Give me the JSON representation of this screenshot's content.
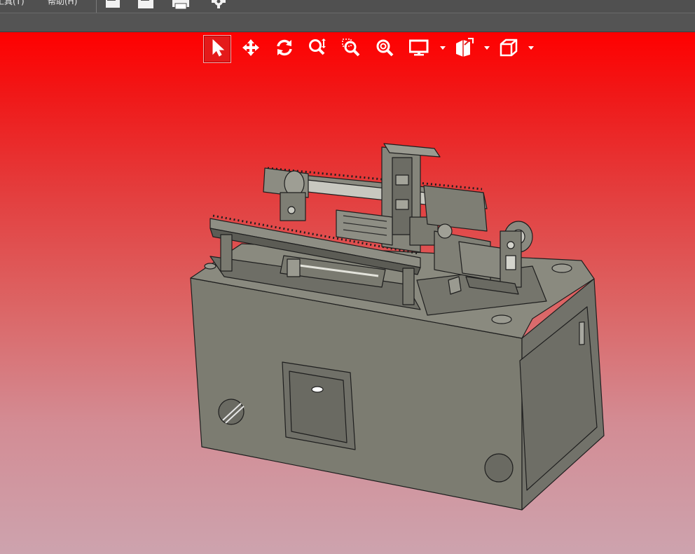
{
  "menubar": {
    "items": [
      {
        "label": "工具(T)"
      },
      {
        "label": "帮助(H)"
      }
    ],
    "icons": [
      "open-file-icon",
      "save-icon",
      "print-icon",
      "settings-icon"
    ]
  },
  "viewer_toolbar": {
    "tools": [
      {
        "name": "select",
        "icon": "select-arrow-icon",
        "active": true
      },
      {
        "name": "pan",
        "icon": "pan-icon",
        "active": false
      },
      {
        "name": "rotate",
        "icon": "rotate-icon",
        "active": false
      },
      {
        "name": "zoom",
        "icon": "zoom-icon",
        "active": false
      },
      {
        "name": "zoom-window",
        "icon": "zoom-window-icon",
        "active": false
      },
      {
        "name": "zoom-fit",
        "icon": "zoom-fit-icon",
        "active": false
      },
      {
        "name": "display-mode",
        "icon": "monitor-icon",
        "dropdown": true
      },
      {
        "name": "section",
        "icon": "section-icon",
        "dropdown": true
      },
      {
        "name": "standard-views",
        "icon": "cube-view-icon",
        "dropdown": true
      }
    ]
  },
  "viewport": {
    "background_top": "#ff0000",
    "background_bottom": "#cda3ae",
    "model_color": "#7b7b70",
    "model_edge_color": "#1e1e1e"
  }
}
